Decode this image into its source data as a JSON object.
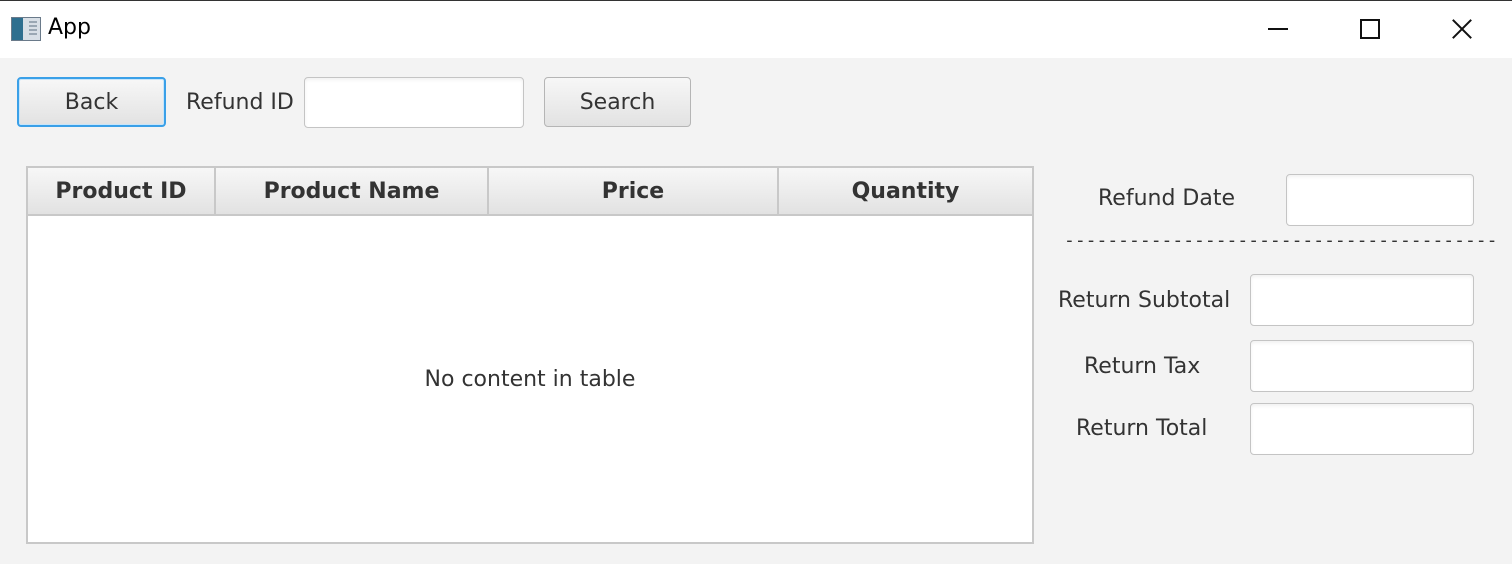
{
  "window": {
    "title": "App",
    "icon": "app-window-icon",
    "controls": {
      "minimize": "minimize-icon",
      "maximize": "maximize-icon",
      "close": "close-icon"
    }
  },
  "toolbar": {
    "back_label": "Back",
    "refund_id_label": "Refund ID",
    "refund_id_value": "",
    "search_label": "Search"
  },
  "table": {
    "columns": [
      "Product ID",
      "Product Name",
      "Price",
      "Quantity"
    ],
    "rows": [],
    "placeholder": "No content in table"
  },
  "summary": {
    "refund_date_label": "Refund Date",
    "refund_date_value": "",
    "separator": "----------------------------------------",
    "return_subtotal_label": "Return Subtotal",
    "return_subtotal_value": "",
    "return_tax_label": "Return Tax",
    "return_tax_value": "",
    "return_total_label": "Return Total",
    "return_total_value": ""
  },
  "colors": {
    "focus_border": "#3aa0e8",
    "background": "#f3f3f3"
  }
}
